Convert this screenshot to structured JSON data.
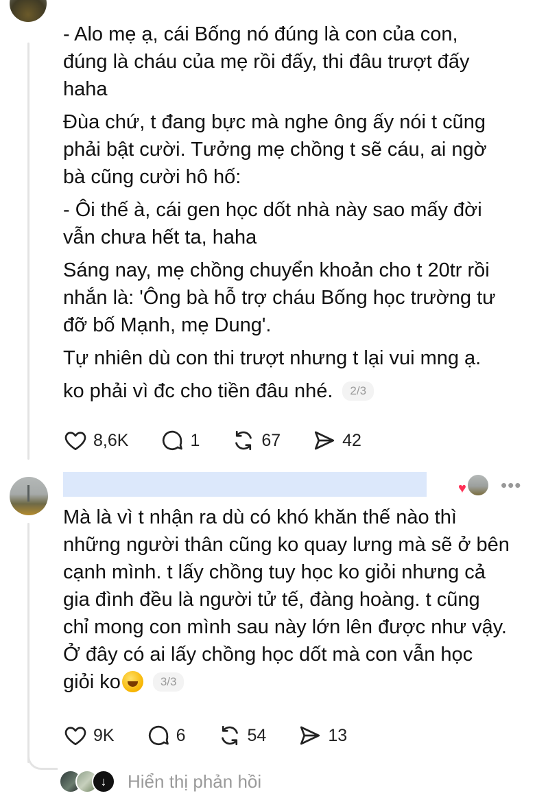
{
  "post_part_2": {
    "paragraphs": [
      "- Alo mẹ ạ, cái Bống nó đúng là con của con,\nđúng là cháu của mẹ rồi đấy, thi đâu trượt đấy\nhaha",
      "Đùa chứ, t đang bực mà nghe ông ấy nói t cũng\nphải bật cười. Tưởng mẹ chồng t sẽ cáu, ai ngờ\nbà cũng cười hô hố:",
      "- Ôi thế à, cái gen học dốt nhà này sao mấy đời\nvẫn chưa hết ta, haha",
      "Sáng nay, mẹ chồng chuyển khoản cho t 20tr rồi\nnhắn là: 'Ông bà hỗ trợ cháu Bống học trường tư\nđỡ bố Mạnh, mẹ Dung'.",
      "Tự nhiên dù con thi trượt nhưng t lại vui mng ạ.",
      "ko phải vì đc cho tiền đâu nhé."
    ],
    "counter": "2/3",
    "likes": "8,6K",
    "replies": "1",
    "reposts": "67",
    "shares": "42"
  },
  "post_part_3": {
    "text": "Mà là vì t nhận ra dù có khó khăn thế nào thì\nnhững người thân cũng ko quay lưng mà sẽ ở bên\ncạnh mình. t lấy chồng tuy học ko giỏi nhưng cả\ngia đình đều là người tử tế, đàng hoàng. t cũng\nchỉ mong con mình sau này lớn lên được như vậy.\nỞ đây có ai lấy chồng học dốt mà con vẫn học\ngiỏi ko",
    "emoji": "rolling-on-floor-laughing",
    "counter": "3/3",
    "likes": "9K",
    "replies": "6",
    "reposts": "54",
    "shares": "13",
    "more": "•••"
  },
  "show_replies": {
    "label": "Hiển thị phản hồi",
    "icon": "arrow-down-icon"
  },
  "colors": {
    "text": "#111111",
    "muted": "#9a9a9a",
    "name_redaction": "#dce8fb",
    "heart": "#ff2f55",
    "thread_line": "#e3e3e3"
  }
}
